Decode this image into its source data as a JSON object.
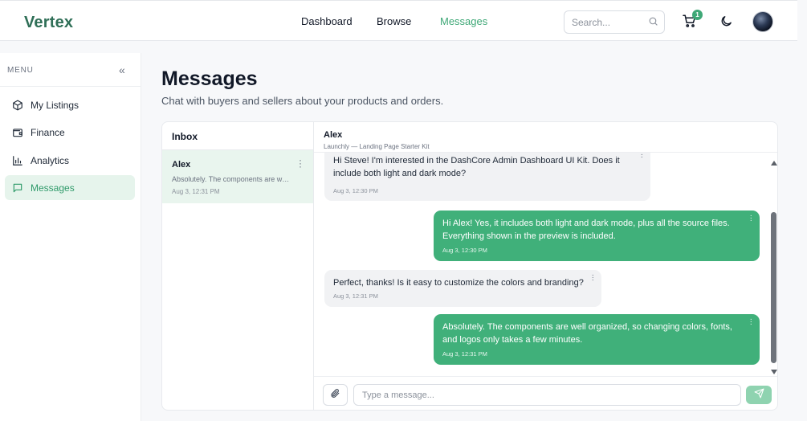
{
  "app": {
    "brand": "Vertex"
  },
  "nav": {
    "items": [
      {
        "label": "Dashboard",
        "active": false
      },
      {
        "label": "Browse",
        "active": false
      },
      {
        "label": "Messages",
        "active": true
      }
    ]
  },
  "header": {
    "search_placeholder": "Search...",
    "cart_count": "1"
  },
  "sidebar": {
    "menu_label": "MENU",
    "collapse_glyph": "«",
    "items": [
      {
        "label": "My Listings",
        "icon": "box-icon",
        "active": false
      },
      {
        "label": "Finance",
        "icon": "wallet-icon",
        "active": false
      },
      {
        "label": "Analytics",
        "icon": "bar-chart-icon",
        "active": false
      },
      {
        "label": "Messages",
        "icon": "message-icon",
        "active": true
      }
    ]
  },
  "page": {
    "title": "Messages",
    "subtitle": "Chat with buyers and sellers about your products and orders."
  },
  "inbox": {
    "title": "Inbox",
    "conversations": [
      {
        "name": "Alex",
        "preview": "Absolutely. The components are well organized, so changing colors, fonts, and logos only takes a few minutes.",
        "time": "Aug 3, 12:31 PM"
      }
    ]
  },
  "chat": {
    "contact": "Alex",
    "context": "Launchly — Landing Page Starter Kit",
    "messages": [
      {
        "dir": "in",
        "text": "Hi Steve! I'm interested in the DashCore Admin Dashboard UI Kit. Does it include both light and dark mode?",
        "time": "Aug 3, 12:30 PM"
      },
      {
        "dir": "out",
        "text": "Hi Alex! Yes, it includes both light and dark mode, plus all the source files. Everything shown in the preview is included.",
        "time": "Aug 3, 12:30 PM"
      },
      {
        "dir": "in",
        "text": "Perfect, thanks! Is it easy to customize the colors and branding?",
        "time": "Aug 3, 12:31 PM"
      },
      {
        "dir": "out",
        "text": "Absolutely. The components are well organized, so changing colors, fonts, and logos only takes a few minutes.",
        "time": "Aug 3, 12:31 PM"
      }
    ],
    "input_placeholder": "Type a message..."
  },
  "colors": {
    "accent": "#40b07a",
    "brand": "#2f6f57",
    "active_bg": "#e6f4ec"
  }
}
